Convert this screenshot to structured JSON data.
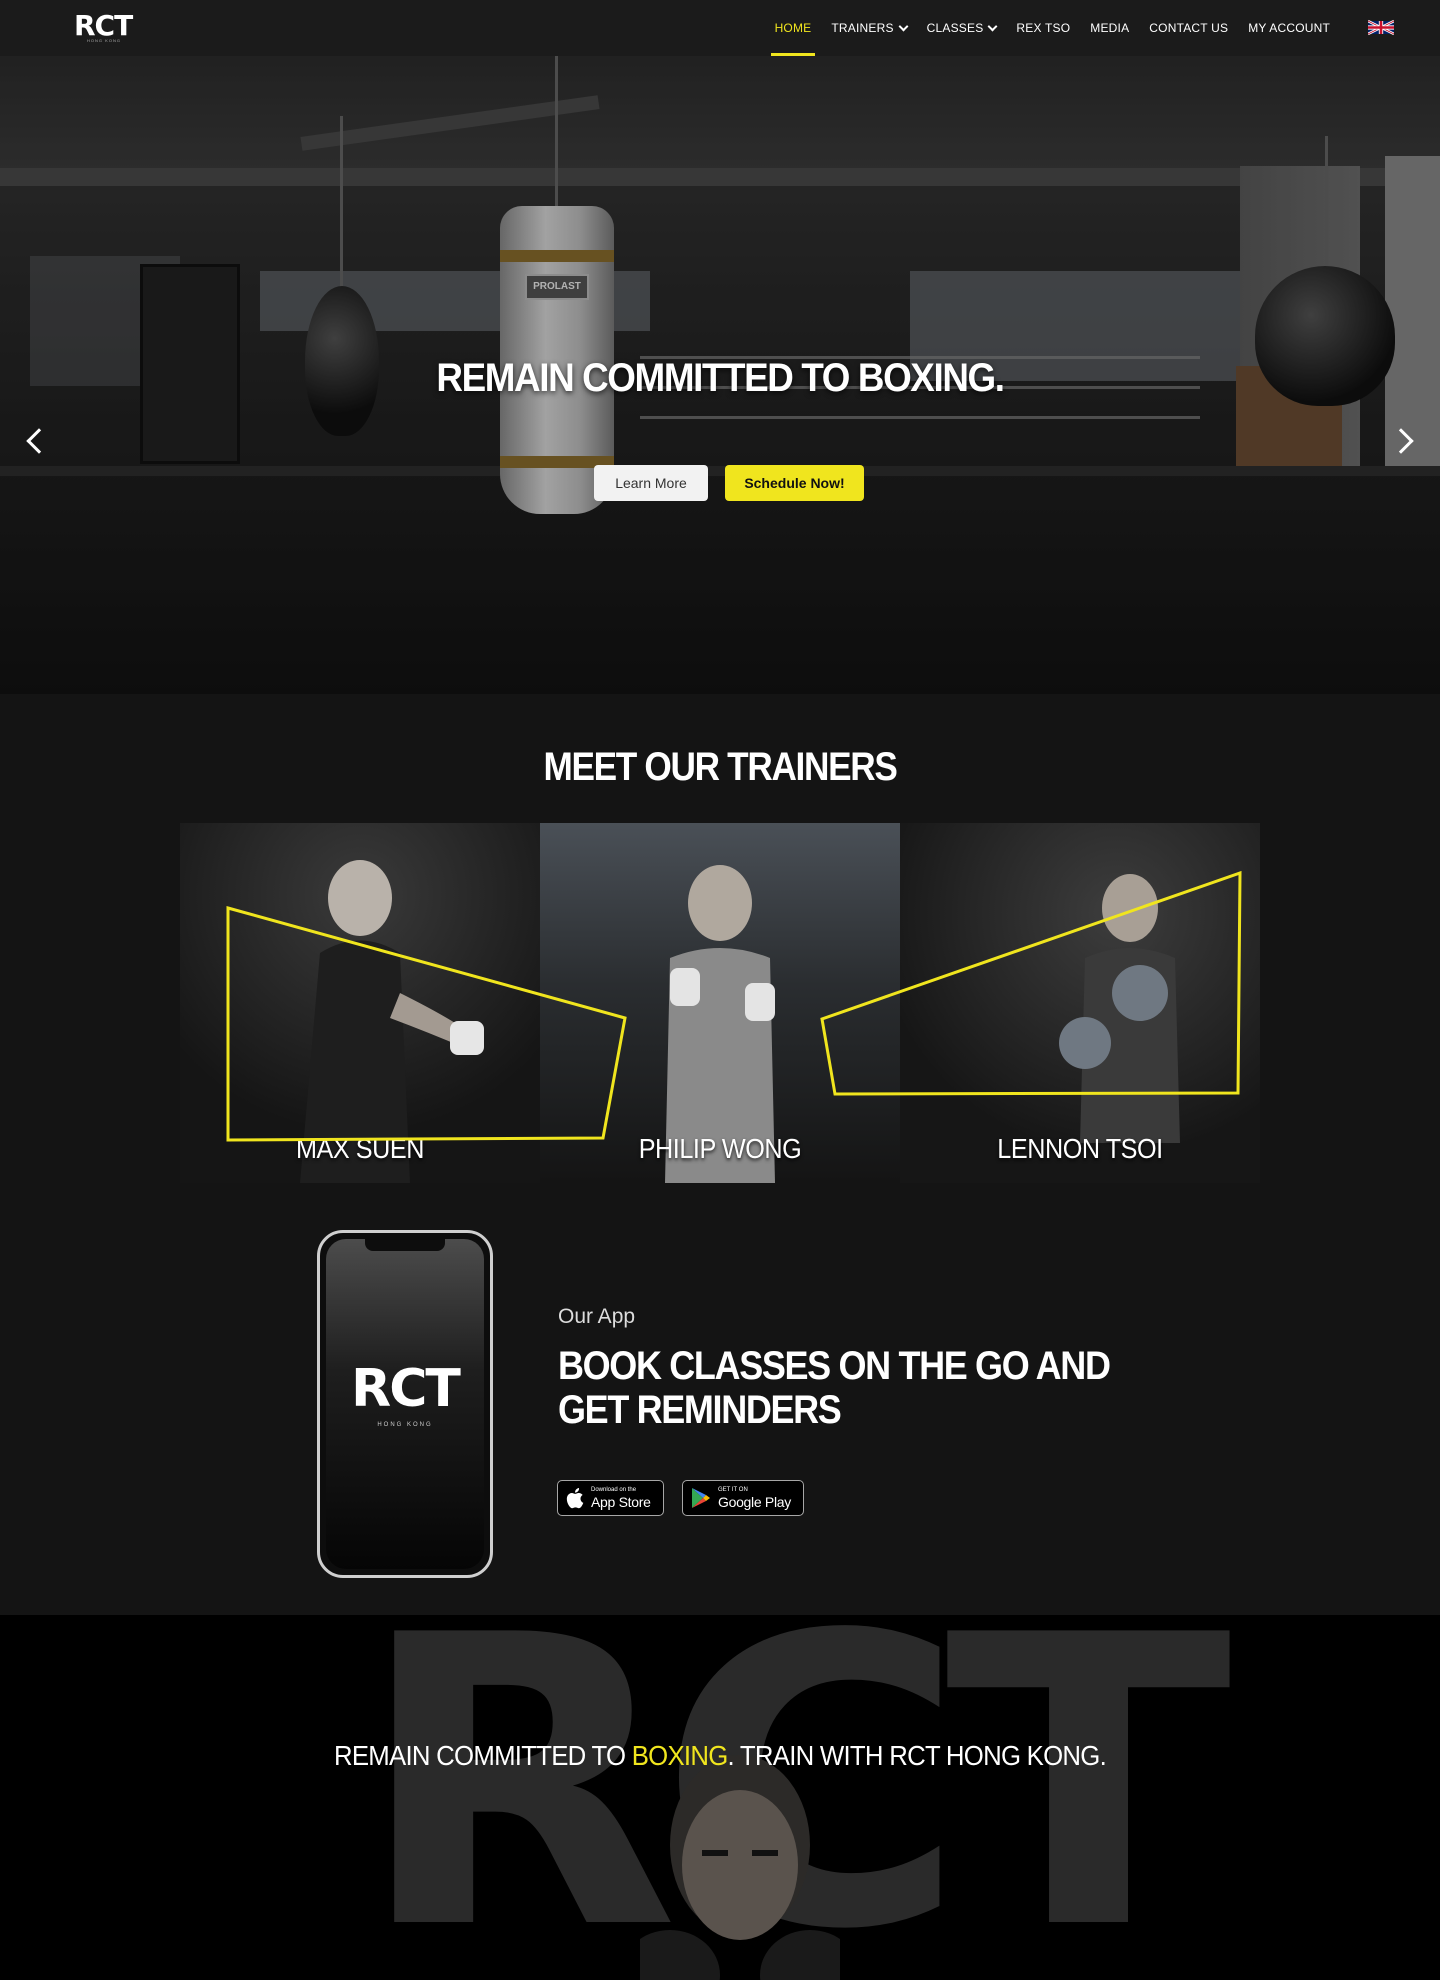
{
  "nav": {
    "logo_text": "RCT",
    "logo_subtitle": "HONG KONG",
    "items": [
      {
        "label": "HOME",
        "active": true,
        "dropdown": false
      },
      {
        "label": "TRAINERS",
        "active": false,
        "dropdown": true
      },
      {
        "label": "CLASSES",
        "active": false,
        "dropdown": true
      },
      {
        "label": "REX TSO",
        "active": false,
        "dropdown": false
      },
      {
        "label": "MEDIA",
        "active": false,
        "dropdown": false
      },
      {
        "label": "CONTACT US",
        "active": false,
        "dropdown": false
      },
      {
        "label": "MY ACCOUNT",
        "active": false,
        "dropdown": false
      }
    ],
    "language_icon": "uk-flag-icon"
  },
  "hero": {
    "bag_brand": "PROLAST",
    "title": "REMAIN COMMITTED TO BOXING.",
    "learn_more_label": "Learn More",
    "schedule_label": "Schedule Now!",
    "prev_icon": "chevron-left-icon",
    "next_icon": "chevron-right-icon"
  },
  "trainers": {
    "title": "MEET OUR TRAINERS",
    "items": [
      {
        "name": "MAX SUEN"
      },
      {
        "name": "PHILIP WONG"
      },
      {
        "name": "LENNON TSOI"
      }
    ]
  },
  "app": {
    "phone_logo": "RCT",
    "phone_subtitle": "HONG KONG",
    "kicker": "Our App",
    "title": "BOOK CLASSES ON THE GO AND GET REMINDERS",
    "app_store_small": "Download on the",
    "app_store_large": "App Store",
    "google_play_small": "GET IT ON",
    "google_play_large": "Google Play"
  },
  "bottom": {
    "watermark": "RCT",
    "text_before": "REMAIN COMMITTED TO ",
    "text_highlight": "BOXING",
    "text_after": ". TRAIN WITH RCT HONG KONG."
  },
  "colors": {
    "accent": "#f0e51e",
    "nav_bg": "#1b1b1b",
    "page_bg": "#141414"
  }
}
